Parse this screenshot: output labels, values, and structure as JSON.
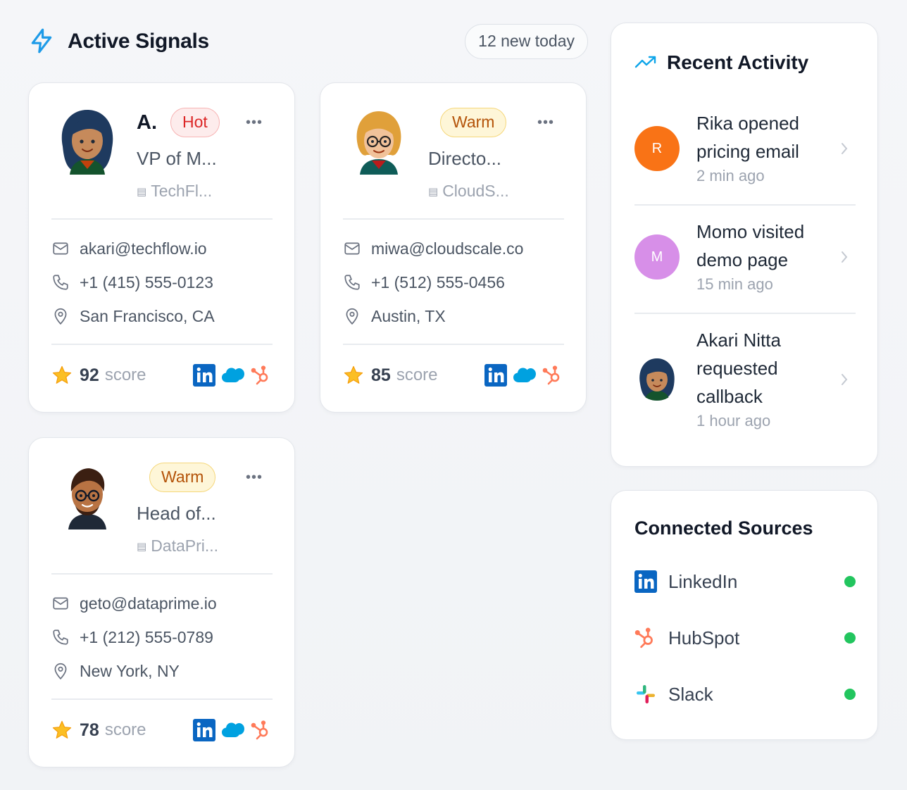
{
  "header": {
    "title": "Active Signals",
    "new_today": "12 new today"
  },
  "contacts": [
    {
      "name": "A.",
      "badge": "Hot",
      "role": "VP of M...",
      "company": "TechFl...",
      "email": "akari@techflow.io",
      "phone": "+1 (415) 555-0123",
      "location": "San Francisco, CA",
      "score": "92",
      "score_label": "score"
    },
    {
      "name": "",
      "badge": "Warm",
      "role": "Directo...",
      "company": "CloudS...",
      "email": "miwa@cloudscale.co",
      "phone": "+1 (512) 555-0456",
      "location": "Austin, TX",
      "score": "85",
      "score_label": "score"
    },
    {
      "name": "",
      "badge": "Warm",
      "role": "Head of...",
      "company": "DataPri...",
      "email": "geto@dataprime.io",
      "phone": "+1 (212) 555-0789",
      "location": "New York, NY",
      "score": "78",
      "score_label": "score"
    }
  ],
  "activity": {
    "title": "Recent Activity",
    "items": [
      {
        "initial": "R",
        "text": "Rika opened pricing email",
        "time": "2 min ago",
        "color": "#f97316"
      },
      {
        "initial": "M",
        "text": "Momo visited demo page",
        "time": "15 min ago",
        "color": "#d78fe8"
      },
      {
        "initial": "",
        "text": "Akari Nitta requested callback",
        "time": "1 hour ago",
        "color": "#ffffff"
      }
    ]
  },
  "sources": {
    "title": "Connected Sources",
    "items": [
      {
        "name": "LinkedIn",
        "icon": "linkedin-icon",
        "status_color": "#22c55e"
      },
      {
        "name": "HubSpot",
        "icon": "hubspot-icon",
        "status_color": "#22c55e"
      },
      {
        "name": "Slack",
        "icon": "slack-icon",
        "status_color": "#22c55e"
      }
    ]
  },
  "colors": {
    "accent": "#0ea5e9",
    "hot": "#dc2626",
    "warm": "#b45309",
    "linkedin": "#0a66c2",
    "salesforce": "#00a1e0",
    "hubspot": "#ff7a59",
    "online": "#22c55e"
  }
}
